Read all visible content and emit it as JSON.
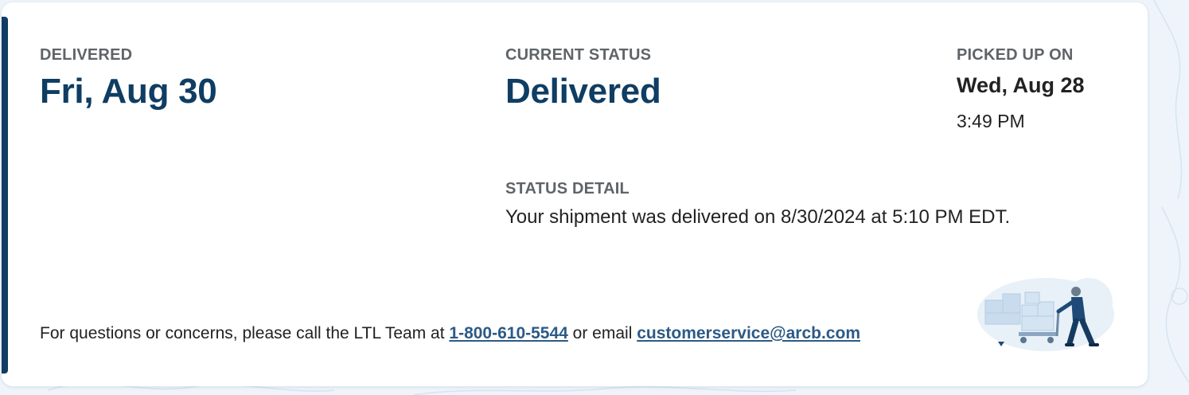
{
  "delivered": {
    "label": "DELIVERED",
    "value": "Fri, Aug 30"
  },
  "current_status": {
    "label": "CURRENT STATUS",
    "value": "Delivered"
  },
  "picked_up": {
    "label": "PICKED UP ON",
    "date": "Wed, Aug 28",
    "time": "3:49 PM"
  },
  "status_detail": {
    "label": "STATUS DETAIL",
    "text": "Your shipment was delivered on 8/30/2024 at 5:10 PM EDT."
  },
  "footer": {
    "prefix": "For questions or concerns, please call the LTL Team at ",
    "phone": "1-800-610-5544",
    "middle": " or email ",
    "email": "customerservice@arcb.com"
  },
  "colors": {
    "accent": "#0f3d63",
    "link": "#2c5a86",
    "label": "#5f6468",
    "background": "#eef4fa"
  },
  "icons": {
    "illustration": "delivery-worker-illustration"
  }
}
